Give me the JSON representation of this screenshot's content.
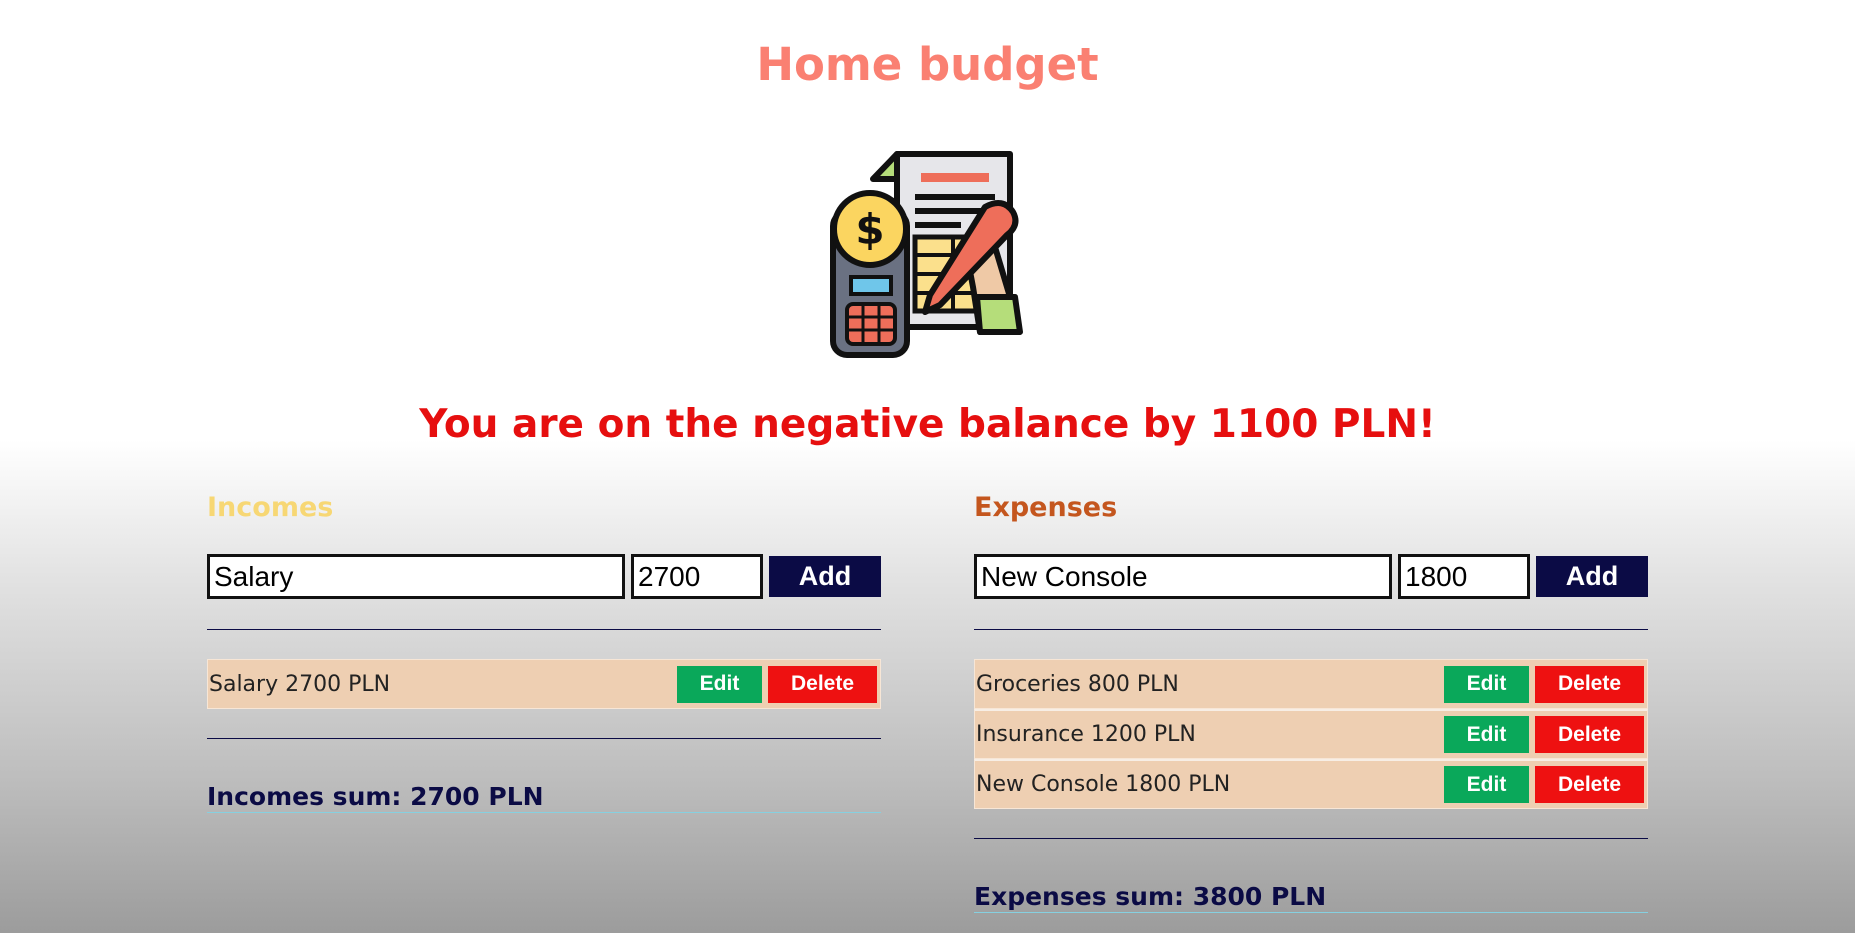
{
  "page": {
    "title": "Home budget",
    "logo_icon": "budget-calculator-invoice-icon"
  },
  "balance_message": "You are on the negative balance by 1100 PLN!",
  "incomes": {
    "heading": "Incomes",
    "name_value": "Salary",
    "amount_value": "2700",
    "add_label": "Add",
    "items": [
      {
        "text": "Salary 2700 PLN",
        "edit_label": "Edit",
        "delete_label": "Delete"
      }
    ],
    "sum_text": "Incomes sum: 2700 PLN"
  },
  "expenses": {
    "heading": "Expenses",
    "name_value": "New Console",
    "amount_value": "1800",
    "add_label": "Add",
    "items": [
      {
        "text": "Groceries 800 PLN",
        "edit_label": "Edit",
        "delete_label": "Delete"
      },
      {
        "text": "Insurance 1200 PLN",
        "edit_label": "Edit",
        "delete_label": "Delete"
      },
      {
        "text": "New Console 1800 PLN",
        "edit_label": "Edit",
        "delete_label": "Delete"
      }
    ],
    "sum_text": "Expenses sum: 3800 PLN"
  },
  "colors": {
    "title": "#fa8072",
    "balance_negative": "#e60f0f",
    "incomes_heading": "#f7d774",
    "expenses_heading": "#c4561e",
    "add_button": "#0b0b45",
    "edit_button": "#0aa85a",
    "delete_button": "#ee1111",
    "item_background": "#eecfb2"
  }
}
